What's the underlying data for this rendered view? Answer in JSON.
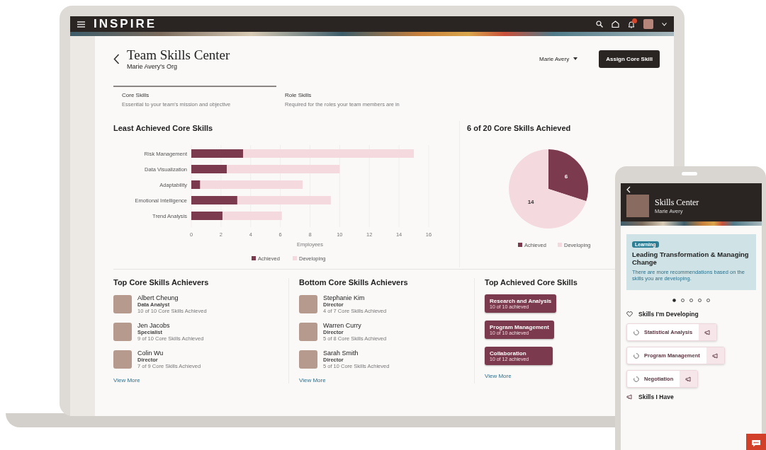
{
  "laptop": {
    "app_bar": {
      "logo": "INSPIRE"
    },
    "page": {
      "title": "Team Skills Center",
      "subtitle": "Marie Avery's Org",
      "person_selector": "Marie Avery",
      "action_button": "Assign Core Skill"
    },
    "tabs": [
      {
        "label": "Core Skills",
        "description": "Essential to your team's mission and objective",
        "selected": true
      },
      {
        "label": "Role Skills",
        "description": "Required for the roles your team members are in",
        "selected": false
      }
    ],
    "bar_card": {
      "title": "Least Achieved Core Skills",
      "chart_data": {
        "type": "bar",
        "orientation": "horizontal",
        "stacked": true,
        "grid": true,
        "legend": "bottom",
        "xlabel": "Employees",
        "categories": [
          "Risk Management",
          "Data Visualization",
          "Adaptability",
          "Emotional Intelligence",
          "Trend Analysis"
        ],
        "series": [
          {
            "name": "Achieved",
            "color": "#7b3a4d",
            "values": [
              3.5,
              2.4,
              0.6,
              3.1,
              2.1
            ]
          },
          {
            "name": "Developing",
            "color": "#f4d9df",
            "values": [
              11.5,
              7.6,
              6.9,
              6.3,
              4
            ]
          }
        ],
        "xlim": [
          0,
          16
        ],
        "xticks": [
          0,
          2,
          4,
          6,
          8,
          10,
          12,
          14,
          16
        ]
      }
    },
    "pie_card": {
      "title": "6 of 20 Core Skills Achieved",
      "chart_data": {
        "type": "pie",
        "data_labels": true,
        "legend": "bottom",
        "categories": [
          "Achieved",
          "Developing"
        ],
        "values": [
          6,
          14
        ],
        "colors": [
          "#7b3a4d",
          "#f4d9df"
        ]
      }
    },
    "top_achievers": {
      "title": "Top Core Skills Achievers",
      "people": [
        {
          "name": "Albert Cheung",
          "role": "Data Analyst",
          "progress": "10 of 10 Core Skills Achieved"
        },
        {
          "name": "Jen Jacobs",
          "role": "Specialist",
          "progress": "9 of 10 Core Skills Achieved"
        },
        {
          "name": "Colin Wu",
          "role": "Director",
          "progress": "7 of 9 Core Skills Achieved"
        }
      ],
      "link": "View More"
    },
    "bottom_achievers": {
      "title": "Bottom Core Skills Achievers",
      "people": [
        {
          "name": "Stephanie Kim",
          "role": "Director",
          "progress": "4 of 7 Core Skills Achieved"
        },
        {
          "name": "Warren Curry",
          "role": "Director",
          "progress": "5 of 8 Core Skills Achieved"
        },
        {
          "name": "Sarah Smith",
          "role": "Director",
          "progress": "5 of 10 Core Skills Achieved"
        }
      ],
      "link": "View More"
    },
    "top_skills": {
      "title": "Top Achieved Core Skills",
      "skills": [
        {
          "name": "Research and Analysis",
          "progress": "10 of 10 achieved"
        },
        {
          "name": "Program Management",
          "progress": "10 of 10 achieved"
        },
        {
          "name": "Collaboration",
          "progress": "10 of 12 achieved"
        }
      ],
      "link": "View More"
    }
  },
  "phone": {
    "header": {
      "title": "Skills Center",
      "subtitle": "Marie Avery"
    },
    "recommendation": {
      "badge": "Learning",
      "title": "Leading Transformation & Managing Change",
      "description": "There are more recommendations based on the skills you are developing."
    },
    "carousel_dots": [
      {
        "selected": true
      },
      {
        "selected": false
      },
      {
        "selected": false
      },
      {
        "selected": false
      },
      {
        "selected": false
      }
    ],
    "developing": {
      "title": "Skills I'm Developing",
      "skills": [
        "Statistical Analysis",
        "Program Management",
        "Negotiation"
      ]
    },
    "next_section": "Skills I Have"
  }
}
